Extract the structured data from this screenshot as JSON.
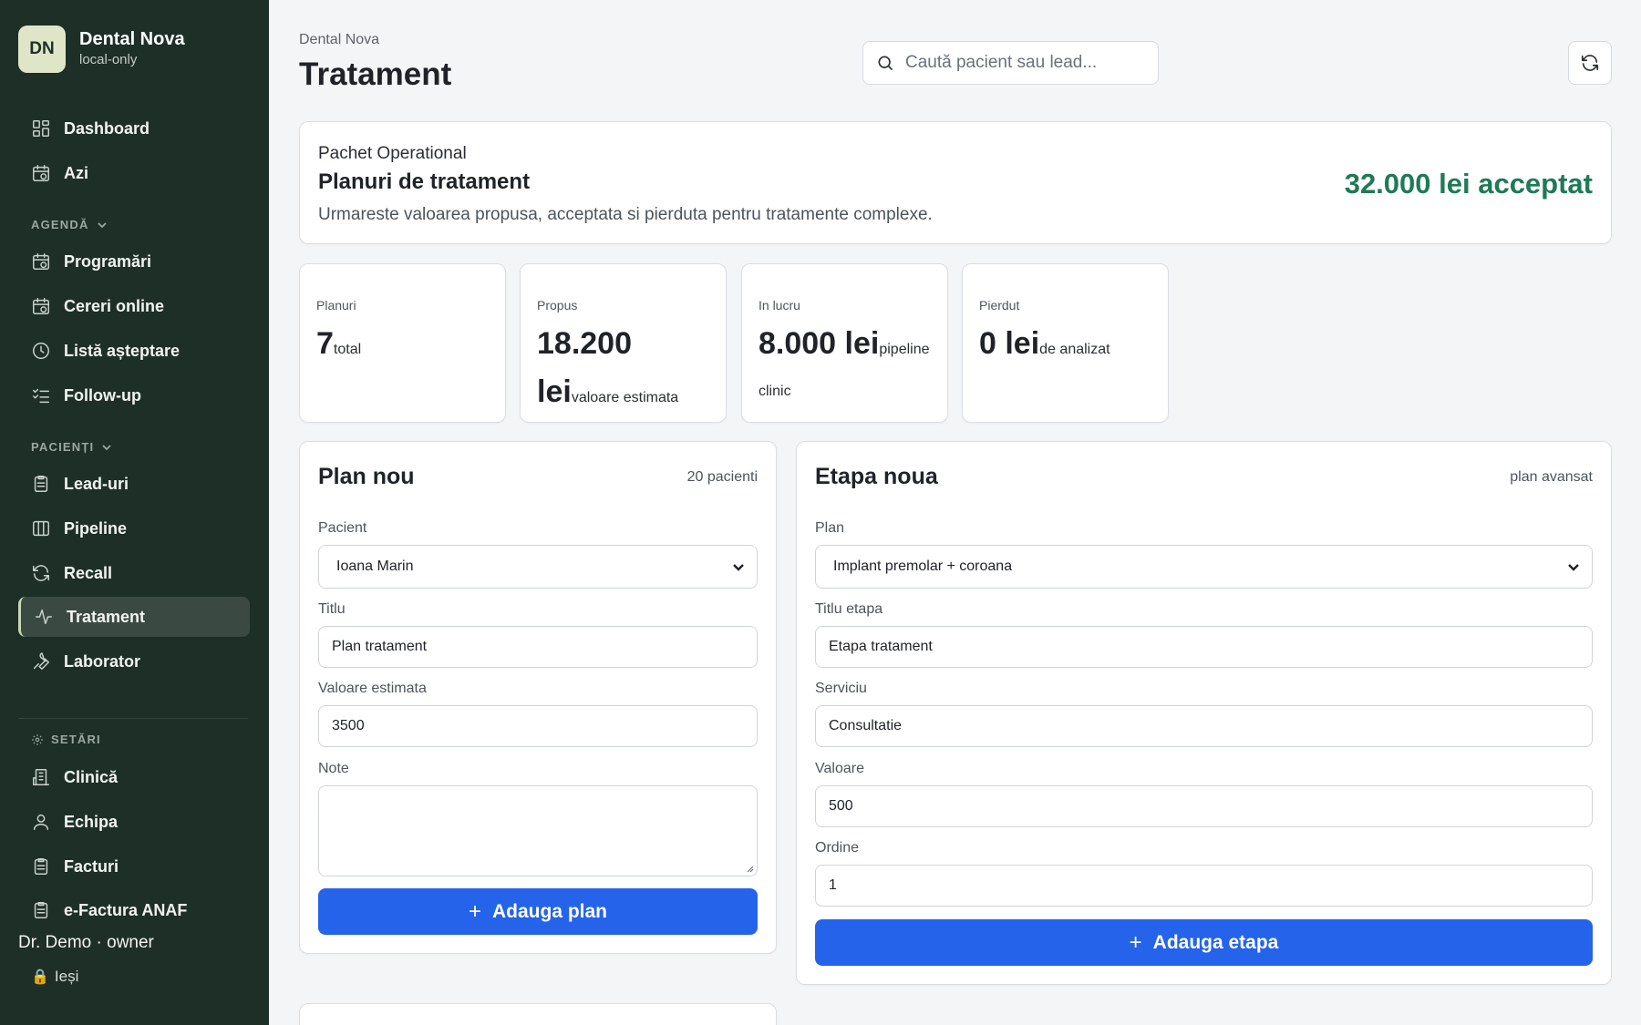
{
  "brand": {
    "initials": "DN",
    "name": "Dental Nova",
    "subtitle": "local-only"
  },
  "nav": {
    "top": [
      {
        "label": "Dashboard",
        "icon": "grid-icon"
      },
      {
        "label": "Azi",
        "icon": "calendar-icon"
      }
    ],
    "agenda_label": "AGENDĂ",
    "agenda": [
      {
        "label": "Programări",
        "icon": "calendar-icon"
      },
      {
        "label": "Cereri online",
        "icon": "calendar-icon"
      },
      {
        "label": "Listă așteptare",
        "icon": "clock-icon"
      },
      {
        "label": "Follow-up",
        "icon": "list-check-icon"
      }
    ],
    "pacienti_label": "PACIENȚI",
    "pacienti": [
      {
        "label": "Lead-uri",
        "icon": "clipboard-icon"
      },
      {
        "label": "Pipeline",
        "icon": "columns-icon"
      },
      {
        "label": "Recall",
        "icon": "refresh-icon"
      },
      {
        "label": "Tratament",
        "icon": "activity-icon",
        "active": true
      },
      {
        "label": "Laborator",
        "icon": "wrench-icon"
      }
    ],
    "setari_label": "SETĂRI",
    "setari": [
      {
        "label": "Clinică",
        "icon": "building-icon"
      },
      {
        "label": "Echipa",
        "icon": "user-icon"
      },
      {
        "label": "Facturi",
        "icon": "clipboard-icon"
      },
      {
        "label": "e-Factura ANAF",
        "icon": "clipboard-icon"
      }
    ]
  },
  "user": {
    "line": "Dr. Demo · owner",
    "logout": "Ieși"
  },
  "header": {
    "breadcrumb": "Dental Nova",
    "title": "Tratament",
    "search_placeholder": "Caută pacient sau lead..."
  },
  "hero": {
    "kicker": "Pachet Operational",
    "title": "Planuri de tratament",
    "description": "Urmareste valoarea propusa, acceptata si pierduta pentru tratamente complexe.",
    "value": "32.000 lei acceptat",
    "value_color": "#1f7a55"
  },
  "stats": [
    {
      "label": "Planuri",
      "value": "7",
      "suffix": "total"
    },
    {
      "label": "Propus",
      "value": "18.200 lei",
      "suffix": "valoare estimata"
    },
    {
      "label": "In lucru",
      "value": "8.000 lei",
      "suffix": "pipeline clinic"
    },
    {
      "label": "Pierdut",
      "value": "0 lei",
      "suffix": "de analizat"
    }
  ],
  "plan_form": {
    "title": "Plan nou",
    "meta": "20 pacienti",
    "patient_label": "Pacient",
    "patient_value": "Ioana Marin",
    "title_label": "Titlu",
    "title_value": "Plan tratament",
    "value_label": "Valoare estimata",
    "value_value": "3500",
    "notes_label": "Note",
    "notes_value": "",
    "button": "Adauga plan"
  },
  "stage_form": {
    "title": "Etapa noua",
    "meta": "plan avansat",
    "plan_label": "Plan",
    "plan_value": "Implant premolar + coroana",
    "stage_title_label": "Titlu etapa",
    "stage_title_value": "Etapa tratament",
    "service_label": "Serviciu",
    "service_value": "Consultatie",
    "value_label": "Valoare",
    "value_value": "500",
    "order_label": "Ordine",
    "order_value": "1",
    "button": "Adauga etapa"
  },
  "colors": {
    "sidebar": "#1e2f28",
    "primary": "#2563eb",
    "accent_green": "#1f7a55"
  }
}
